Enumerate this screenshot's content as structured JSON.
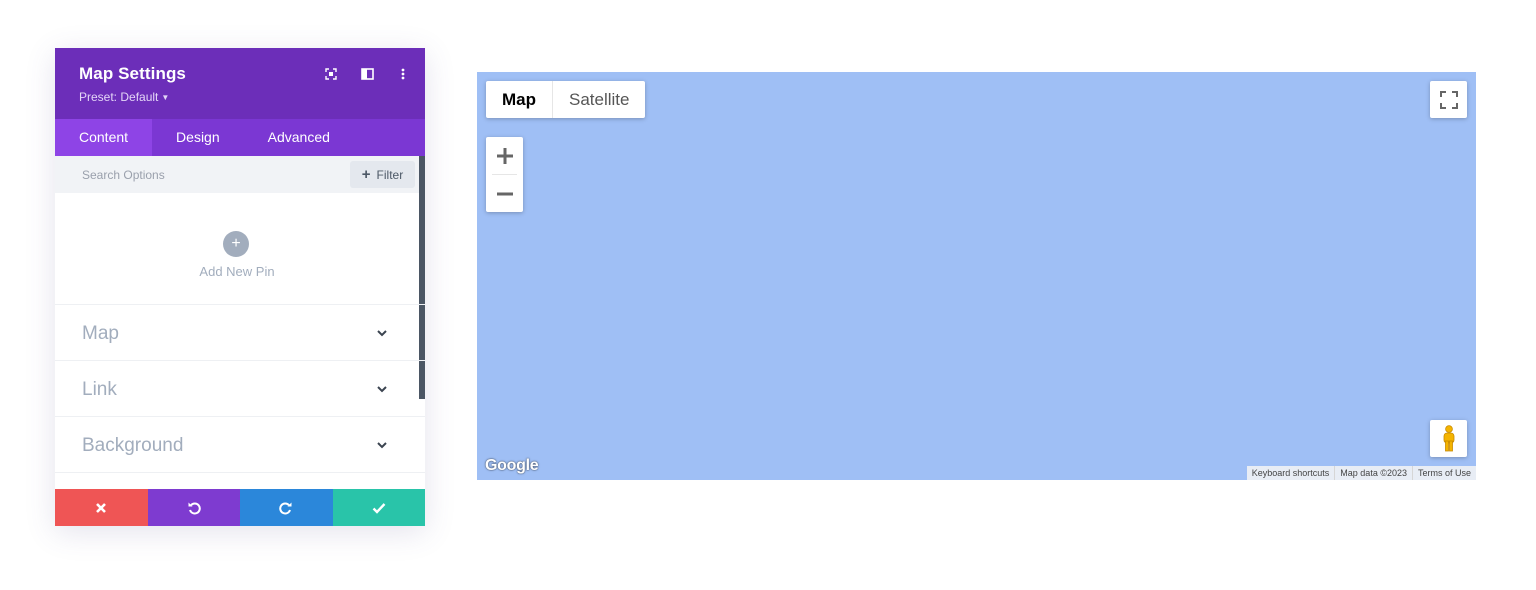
{
  "panel": {
    "title": "Map Settings",
    "preset_label": "Preset: Default",
    "tabs": [
      {
        "label": "Content",
        "active": true
      },
      {
        "label": "Design",
        "active": false
      },
      {
        "label": "Advanced",
        "active": false
      }
    ],
    "search": {
      "placeholder": "Search Options",
      "value": ""
    },
    "filter_label": "Filter",
    "add_pin_label": "Add New Pin",
    "toggles": [
      {
        "label": "Map"
      },
      {
        "label": "Link"
      },
      {
        "label": "Background"
      }
    ],
    "colors": {
      "header": "#6c2eb9",
      "tabs": "#7b37d3",
      "tab_active": "#8e44e6",
      "discard": "#ef5555",
      "undo": "#7e3bd0",
      "redo": "#2b87da",
      "save": "#29c4a9"
    }
  },
  "map": {
    "type_buttons": [
      {
        "label": "Map",
        "active": true
      },
      {
        "label": "Satellite",
        "active": false
      }
    ],
    "logo_text": "Google",
    "footer": {
      "shortcuts": "Keyboard shortcuts",
      "data": "Map data ©2023",
      "terms": "Terms of Use"
    },
    "water_color": "#9fbff5"
  }
}
